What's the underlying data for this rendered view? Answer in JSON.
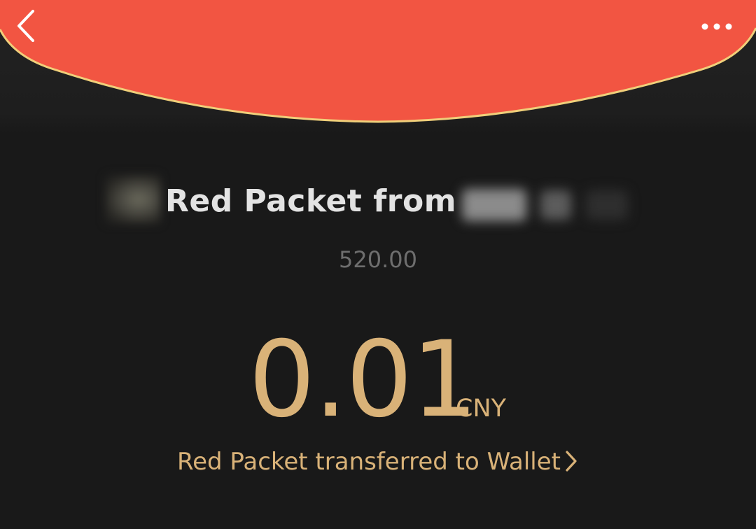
{
  "header": {
    "back_icon": "chevron-left-icon",
    "more_icon": "more-horizontal-icon",
    "accent_color": "#F25542",
    "rim_color": "#F0CF7A"
  },
  "packet": {
    "title": "Red Packet from",
    "memo": "520.00",
    "amount": "0.01",
    "currency": "CNY",
    "wallet_link": "Red Packet transferred to Wallet",
    "amount_color": "#D9B278"
  }
}
